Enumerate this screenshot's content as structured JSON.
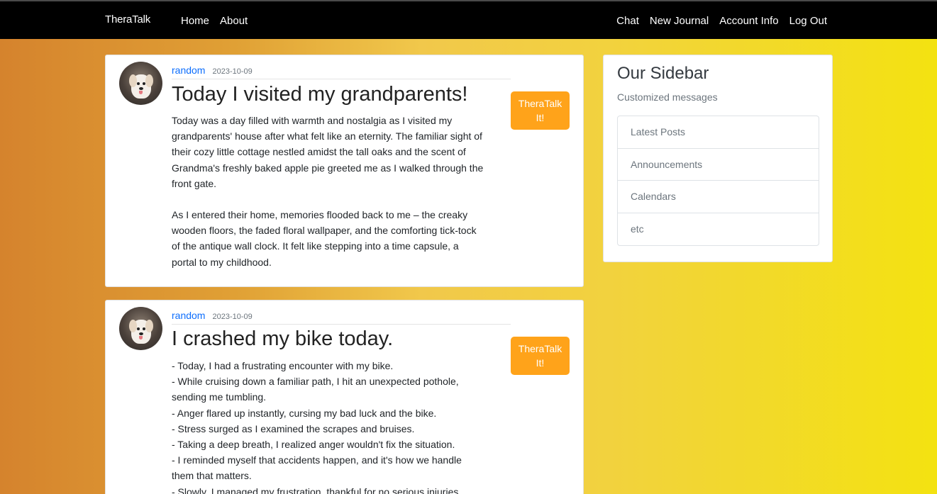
{
  "nav": {
    "brand": "TheraTalk",
    "left": [
      "Home",
      "About"
    ],
    "right": [
      "Chat",
      "New Journal",
      "Account Info",
      "Log Out"
    ]
  },
  "posts": [
    {
      "author": "random",
      "date": "2023-10-09",
      "title": "Today I visited my grandparents!",
      "button_line1": "TheraTalk",
      "button_line2": "It!",
      "paragraphs": [
        [
          "Today was a day filled with warmth and nostalgia as I visited my",
          "grandparents' house after what felt like an eternity. The familiar sight of",
          "their cozy little cottage nestled amidst the tall oaks and the scent of",
          "Grandma's freshly baked apple pie greeted me as I walked through the",
          "front gate."
        ],
        [
          "As I entered their home, memories flooded back to me – the creaky",
          "wooden floors, the faded floral wallpaper, and the comforting tick-tock",
          "of the antique wall clock. It felt like stepping into a time capsule, a",
          "portal to my childhood."
        ]
      ]
    },
    {
      "author": "random",
      "date": "2023-10-09",
      "title": "I crashed my bike today.",
      "button_line1": "TheraTalk",
      "button_line2": "It!",
      "lines": [
        "- Today, I had a frustrating encounter with my bike.",
        "- While cruising down a familiar path, I hit an unexpected pothole,",
        "sending me tumbling.",
        "- Anger flared up instantly, cursing my bad luck and the bike.",
        "- Stress surged as I examined the scrapes and bruises.",
        "- Taking a deep breath, I realized anger wouldn't fix the situation.",
        "- I reminded myself that accidents happen, and it's how we handle",
        "them that matters.",
        "- Slowly, I managed my frustration, thankful for no serious injuries."
      ]
    }
  ],
  "sidebar": {
    "title": "Our Sidebar",
    "subtitle": "Customized messages",
    "items": [
      "Latest Posts",
      "Announcements",
      "Calendars",
      "etc"
    ]
  },
  "colors": {
    "navbar": "#000000",
    "button": "#ffa31a",
    "link": "#0d6efd",
    "gradient_start": "#d5832d",
    "gradient_end": "#f3e211"
  },
  "icons": [
    "dog-avatar-icon"
  ]
}
